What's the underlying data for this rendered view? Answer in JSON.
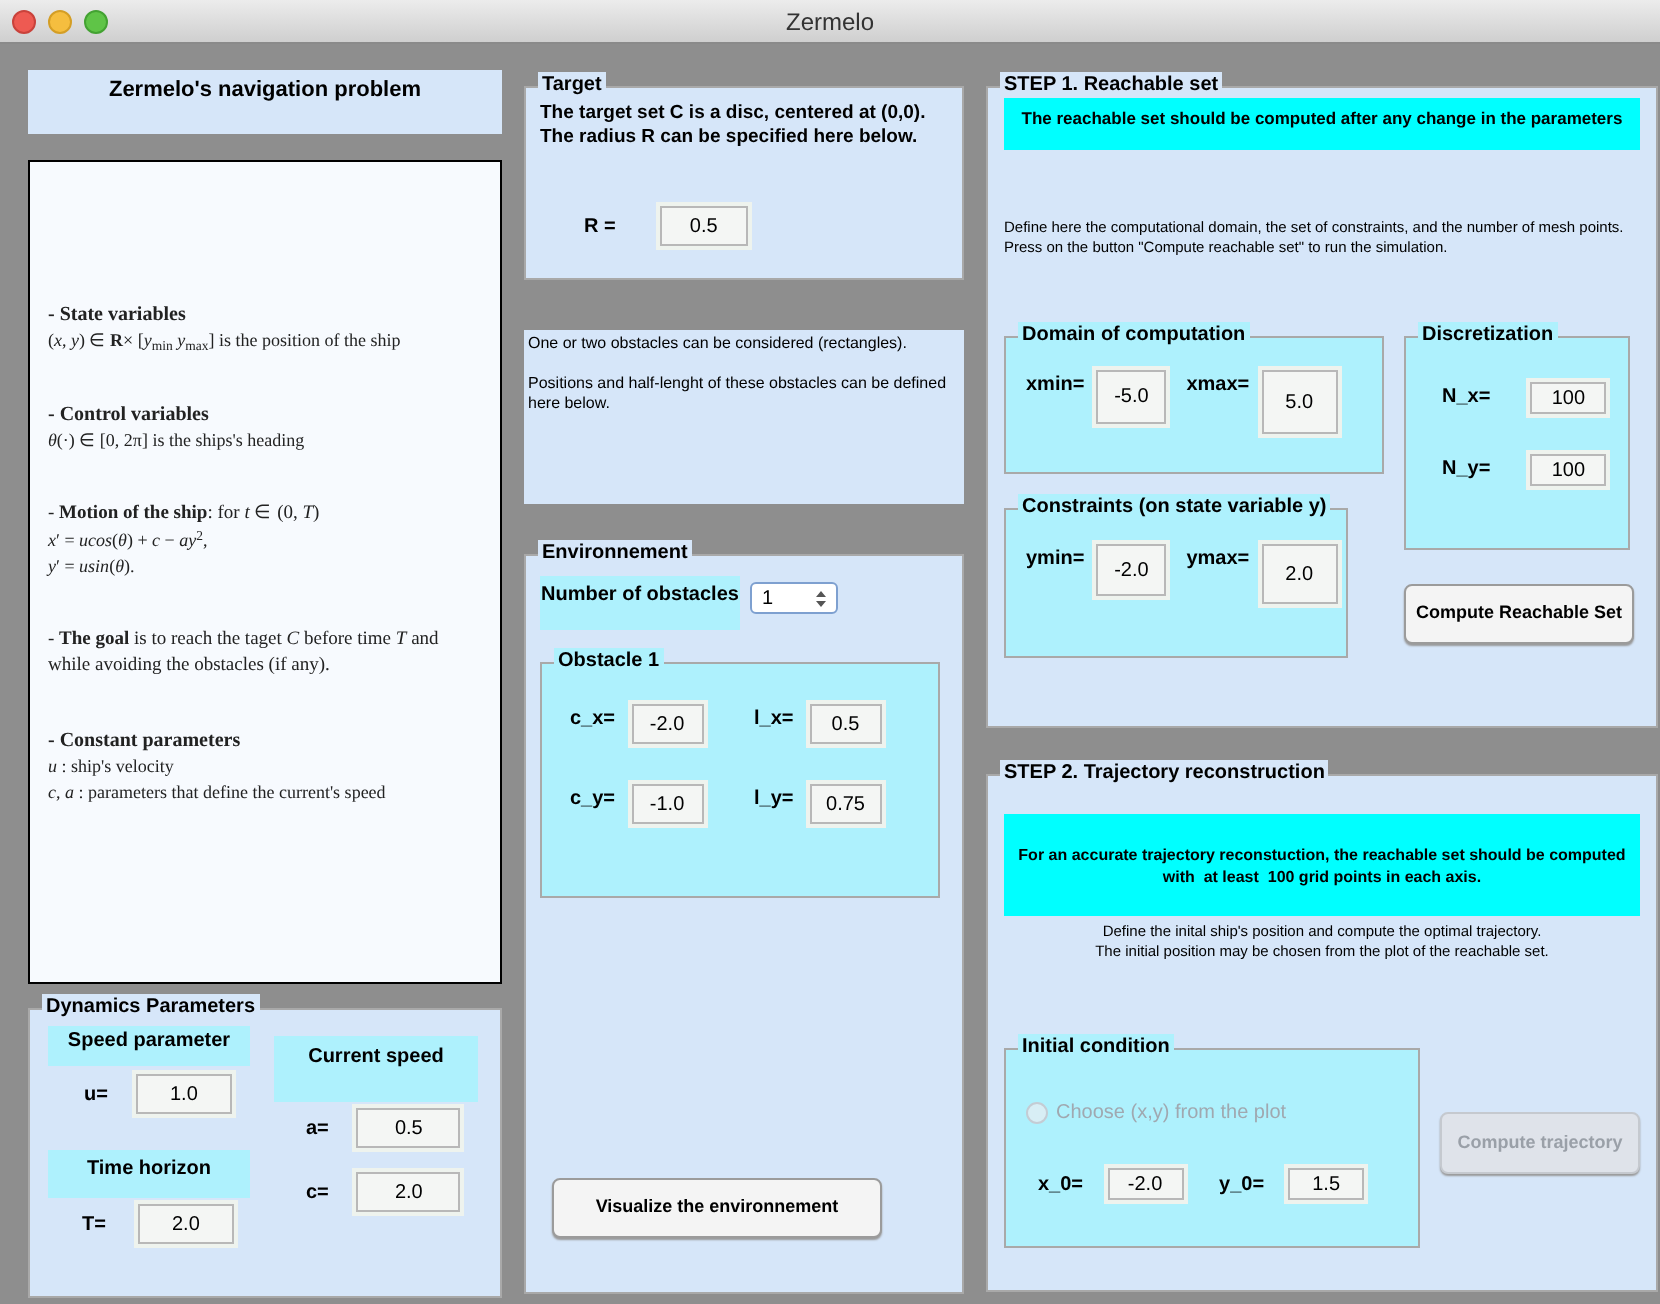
{
  "window": {
    "title": "Zermelo"
  },
  "app_title": "Zermelo's navigation problem",
  "description": [
    {
      "kind": "title",
      "heading": "- State variables",
      "lines": [
        "(*x*, *y*) ∈ **R**× [*y*$_{min}$ *y*$_{max}$] is the position of the ship"
      ]
    },
    {
      "kind": "title",
      "heading": "- Control variables",
      "lines": [
        "*θ*(·) ∈ [0, 2π] is the ships's heading"
      ]
    },
    {
      "kind": "sentence",
      "heading": "- **Motion of the ship**: for *t* ∈ (0, *T*)",
      "lines": [
        "*x*′ = *ucos*(*θ*) + *c* − *ay*$^{2}$,",
        "*y*′ = *usin*(*θ*)."
      ]
    },
    {
      "kind": "sentence",
      "heading": "- **The goal** is to reach the taget *C* before time *T* and while avoiding the obstacles (if any)."
    },
    {
      "kind": "title",
      "heading": "- Constant parameters",
      "lines": [
        "*u* : ship's velocity",
        "*c*, *a* : parameters that define the current's speed"
      ]
    }
  ],
  "dynamics": {
    "title": "Dynamics Parameters",
    "speed_header": "Speed parameter",
    "u": {
      "label": "u=",
      "value": "1.0"
    },
    "time_header": "Time horizon",
    "T": {
      "label": "T=",
      "value": "2.0"
    },
    "current_header": "Current speed",
    "a": {
      "label": "a=",
      "value": "0.5"
    },
    "c": {
      "label": "c=",
      "value": "2.0"
    }
  },
  "target": {
    "title": "Target",
    "text": "The target set C is a disc, centered at (0,0).\nThe radius R can be specified here below.",
    "R": {
      "label": "R =",
      "value": "0.5"
    }
  },
  "obstacles_info": {
    "text": "One or two obstacles can be considered (rectangles).\n\nPositions and half-lenght of these obstacles can be defined here below."
  },
  "environment": {
    "title": "Environnement",
    "count_label": "Number of obstacles",
    "count": "1",
    "obstacle": {
      "title": "Obstacle 1",
      "fields": [
        {
          "label": "c_x=",
          "value": "-2.0"
        },
        {
          "label": "l_x=",
          "value": "0.5"
        },
        {
          "label": "c_y=",
          "value": "-1.0"
        },
        {
          "label": "l_y=",
          "value": "0.75"
        }
      ]
    },
    "button": "Visualize the environnement"
  },
  "step1": {
    "title": "STEP 1. Reachable set",
    "banner": "The reachable set should be computed after any change in the parameters",
    "text": "Define here the computational domain, the set of constraints, and the number of mesh points.\nPress on the  button \"Compute reachable set\" to run the simulation.",
    "domain": {
      "title": "Domain of computation",
      "fields": [
        {
          "label": "xmin=",
          "value": "-5.0"
        },
        {
          "label": "xmax=",
          "value": "5.0"
        }
      ]
    },
    "constraints": {
      "title": "Constraints (on state variable y)",
      "fields": [
        {
          "label": "ymin=",
          "value": "-2.0"
        },
        {
          "label": "ymax=",
          "value": "2.0"
        }
      ]
    },
    "discretization": {
      "title": "Discretization",
      "fields": [
        {
          "label": "N_x=",
          "value": "100"
        },
        {
          "label": "N_y=",
          "value": "100"
        }
      ]
    },
    "button": {
      "label": "Compute Reachable Set",
      "disabled": false
    }
  },
  "step2": {
    "title": "STEP 2. Trajectory reconstruction",
    "banner": "For an accurate trajectory reconstuction, the reachable set should be computed\nwith  at least  100 grid points in each axis.",
    "text": "Define the inital ship's position and compute the optimal trajectory.\nThe initial  position may be chosen from the plot of the reachable set.",
    "initial": {
      "title": "Initial condition",
      "radio": {
        "label": "Choose (x,y)  from the plot",
        "selected": false,
        "disabled": true
      },
      "fields": [
        {
          "label": "x_0=",
          "value": "-2.0"
        },
        {
          "label": "y_0=",
          "value": "1.5"
        }
      ]
    },
    "button": {
      "label": "Compute trajectory",
      "disabled": true
    }
  }
}
